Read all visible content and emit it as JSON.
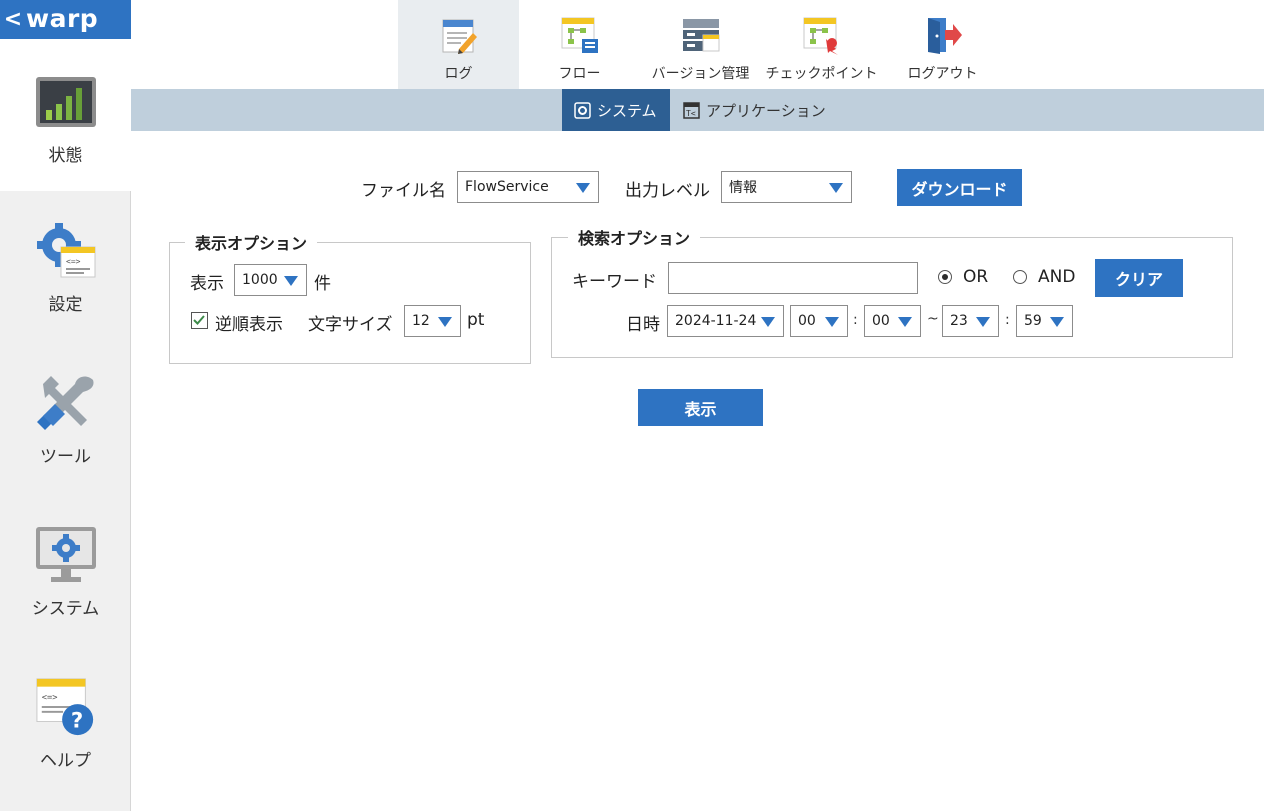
{
  "app": {
    "logo_text": "warp",
    "back_glyph": "<"
  },
  "sidebar": {
    "items": [
      {
        "label": "状態",
        "icon": "bar-chart-monitor-icon"
      },
      {
        "label": "設定",
        "icon": "gear-document-icon"
      },
      {
        "label": "ツール",
        "icon": "wrench-screwdriver-icon"
      },
      {
        "label": "システム",
        "icon": "monitor-gear-icon"
      },
      {
        "label": "ヘルプ",
        "icon": "document-help-icon"
      }
    ]
  },
  "topnav": {
    "tabs": [
      {
        "label": "ログ",
        "icon": "log-notepad-icon"
      },
      {
        "label": "フロー",
        "icon": "flow-icon"
      },
      {
        "label": "バージョン管理",
        "icon": "version-control-icon"
      },
      {
        "label": "チェックポイント",
        "icon": "checkpoint-icon"
      },
      {
        "label": "ログアウト",
        "icon": "logout-door-icon"
      }
    ]
  },
  "subnav": {
    "tabs": [
      {
        "label": "システム",
        "icon": "system-icon"
      },
      {
        "label": "アプリケーション",
        "icon": "application-icon"
      }
    ]
  },
  "log_form": {
    "file_label": "ファイル名",
    "file_value": "FlowService",
    "level_label": "出力レベル",
    "level_value": "情報",
    "download_label": "ダウンロード"
  },
  "display_options": {
    "legend": "表示オプション",
    "count_label": "表示",
    "count_value": "1000",
    "count_unit": "件",
    "reverse_label": "逆順表示",
    "reverse_checked": true,
    "fontsize_label": "文字サイズ",
    "fontsize_value": "12",
    "fontsize_unit": "pt"
  },
  "search_options": {
    "legend": "検索オプション",
    "keyword_label": "キーワード",
    "keyword_value": "",
    "or_label": "OR",
    "and_label": "AND",
    "selected_mode": "OR",
    "clear_label": "クリア",
    "datetime_label": "日時",
    "date_value": "2024-11-24",
    "from_hour": "00",
    "from_minute": "00",
    "range_sep": "~",
    "time_sep": ":",
    "to_hour": "23",
    "to_minute": "59"
  },
  "show_button_label": "表示",
  "colors": {
    "accent": "#2e73c2",
    "subnav_bg": "#bfcfdc",
    "subnav_active": "#2d5f93",
    "sidebar_bg": "#f0f0f0"
  }
}
